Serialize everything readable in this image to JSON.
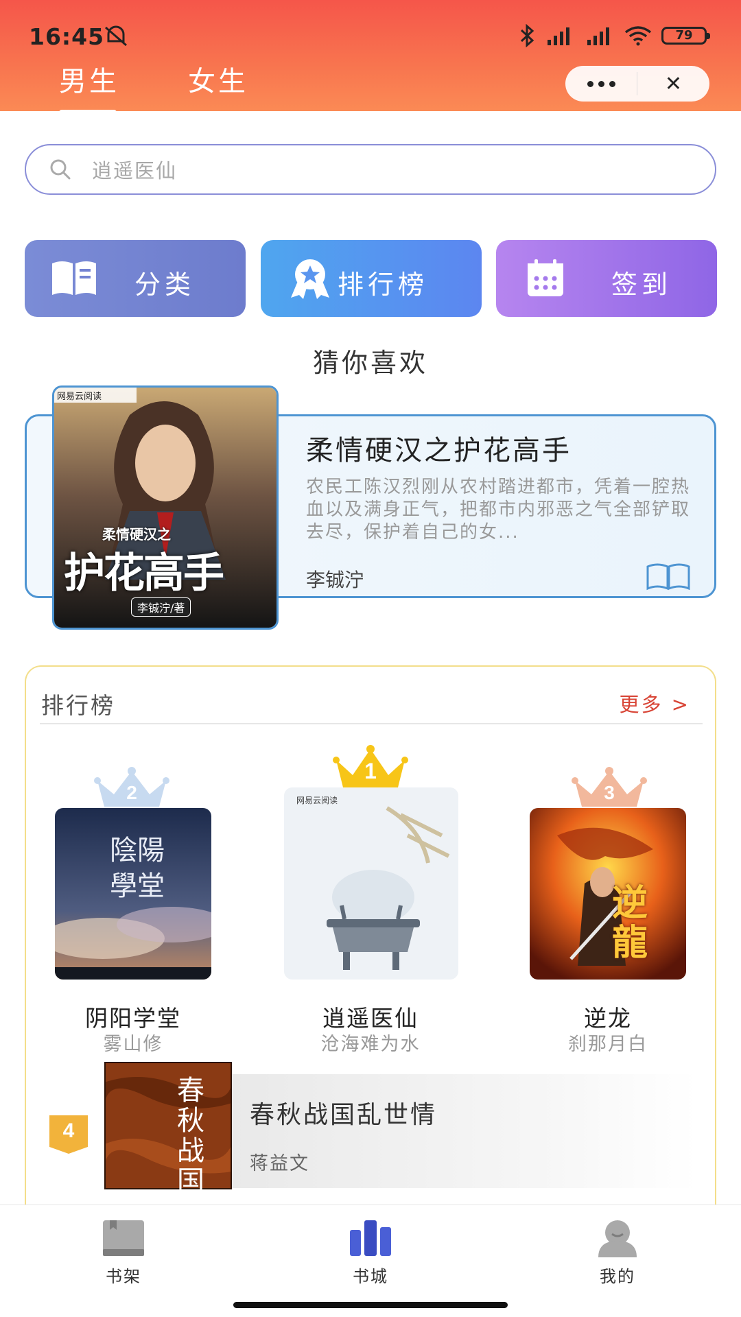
{
  "status_bar": {
    "time": "16:45",
    "battery": "79"
  },
  "header": {
    "tabs": [
      {
        "label": "男生",
        "active": true
      },
      {
        "label": "女生",
        "active": false
      }
    ],
    "capsule": {
      "more_icon": "more-icon",
      "close_label": "✕"
    }
  },
  "search": {
    "placeholder": "逍遥医仙"
  },
  "quick_actions": [
    {
      "label": "分类",
      "icon": "book-open-icon"
    },
    {
      "label": "排行榜",
      "icon": "award-ribbon-icon"
    },
    {
      "label": "签到",
      "icon": "calendar-icon"
    }
  ],
  "recommend": {
    "section_title": "猜你喜欢",
    "title": "柔情硬汉之护花高手",
    "description": "农民工陈汉烈刚从农村踏进都市，凭着一腔热血以及满身正气，把都市内邪恶之气全部铲取去尽，保护着自己的女...",
    "author": "李铖泞",
    "cover": {
      "publisher": "网易云阅读",
      "small_title": "柔情硬汉之",
      "big_title": "护花高手",
      "author_tag": "李铖泞/著"
    }
  },
  "ranking": {
    "title": "排行榜",
    "more_label": "更多 >",
    "top": [
      {
        "rank": "2",
        "name": "阴阳学堂",
        "author": "雾山修",
        "cover_text": "陰陽學堂"
      },
      {
        "rank": "1",
        "name": "逍遥医仙",
        "author": "沧海难为水",
        "cover_text": "网易云阅读"
      },
      {
        "rank": "3",
        "name": "逆龙",
        "author": "刹那月白",
        "cover_text": "逆龍"
      }
    ],
    "fourth": {
      "rank": "4",
      "name": "春秋战国乱世情",
      "author": "蒋益文",
      "cover_text": "春秋战国"
    }
  },
  "colors": {
    "header_start": "#f5564a",
    "header_end": "#fb8a55",
    "more_link": "#d84435",
    "rank_border": "#f3de8a"
  },
  "bottom_nav": [
    {
      "label": "书架",
      "icon": "bookshelf-icon"
    },
    {
      "label": "书城",
      "icon": "bookstore-icon",
      "active": true
    },
    {
      "label": "我的",
      "icon": "profile-icon"
    }
  ]
}
